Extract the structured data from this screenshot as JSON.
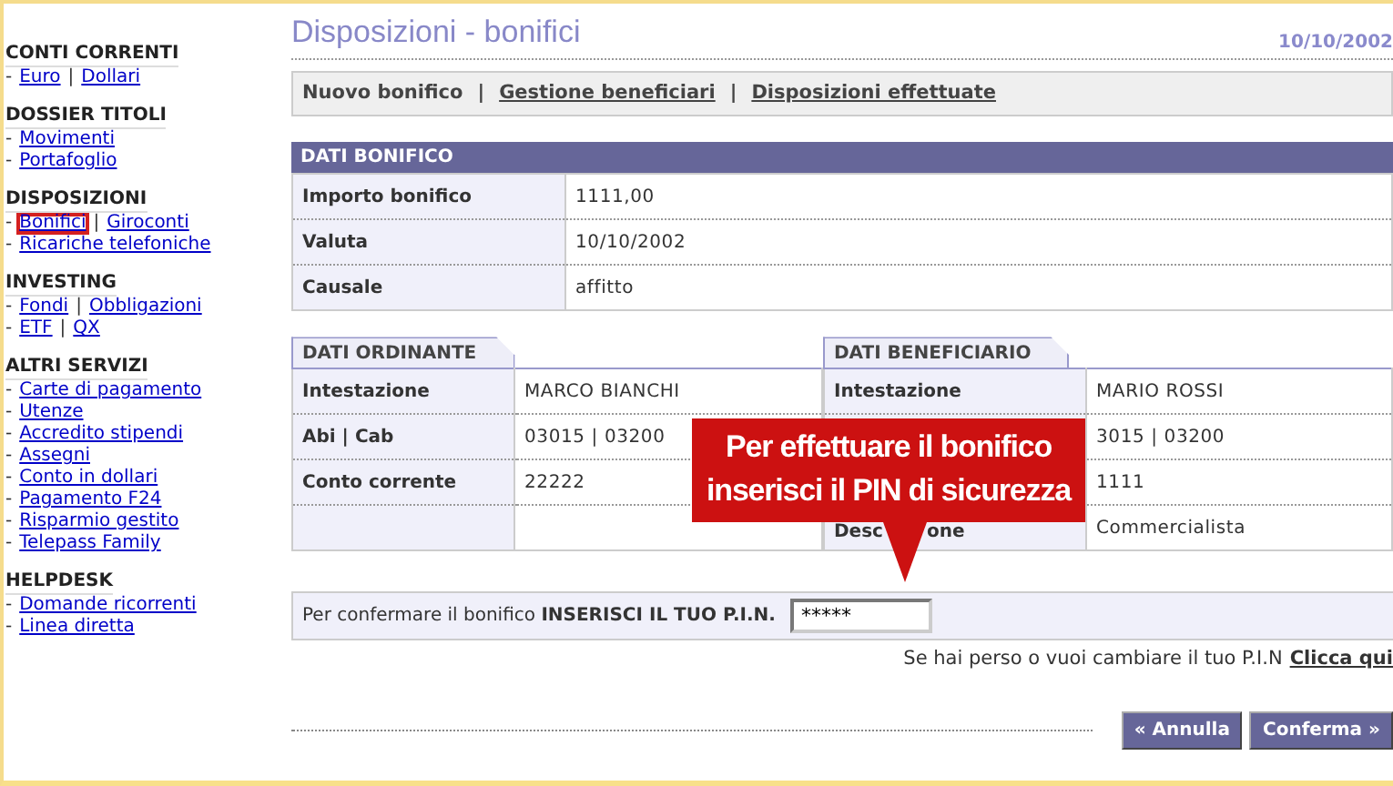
{
  "sidebar": [
    {
      "title": "CONTI CORRENTI",
      "lines": [
        {
          "marker": "-",
          "links": [
            {
              "label": "Euro",
              "highlighted": false
            },
            {
              "label": "Dollari",
              "highlighted": false
            }
          ],
          "separators": [
            "|"
          ]
        }
      ]
    },
    {
      "title": "DOSSIER TITOLI",
      "lines": [
        {
          "marker": "-",
          "links": [
            {
              "label": "Movimenti",
              "highlighted": false
            }
          ]
        },
        {
          "marker": "-",
          "links": [
            {
              "label": "Portafoglio",
              "highlighted": false
            }
          ]
        }
      ]
    },
    {
      "title": "DISPOSIZIONI",
      "lines": [
        {
          "marker": "-",
          "links": [
            {
              "label": "Bonifici",
              "highlighted": true
            },
            {
              "label": "Giroconti",
              "highlighted": false
            }
          ],
          "separators": [
            "|"
          ]
        },
        {
          "marker": "-",
          "links": [
            {
              "label": "Ricariche telefoniche",
              "highlighted": false
            }
          ]
        }
      ]
    },
    {
      "title": "INVESTING",
      "lines": [
        {
          "marker": "-",
          "links": [
            {
              "label": "Fondi",
              "highlighted": false
            },
            {
              "label": "Obbligazioni",
              "highlighted": false
            }
          ],
          "separators": [
            "|"
          ]
        },
        {
          "marker": "-",
          "links": [
            {
              "label": "ETF",
              "highlighted": false
            },
            {
              "label": "QX",
              "highlighted": false
            }
          ],
          "separators": [
            "|"
          ]
        }
      ]
    },
    {
      "title": "ALTRI SERVIZI",
      "lines": [
        {
          "marker": "-",
          "links": [
            {
              "label": "Carte di pagamento",
              "highlighted": false
            }
          ]
        },
        {
          "marker": "-",
          "links": [
            {
              "label": "Utenze",
              "highlighted": false
            }
          ]
        },
        {
          "marker": "-",
          "links": [
            {
              "label": "Accredito stipendi",
              "highlighted": false
            }
          ]
        },
        {
          "marker": "-",
          "links": [
            {
              "label": "Assegni",
              "highlighted": false
            }
          ]
        },
        {
          "marker": "-",
          "links": [
            {
              "label": "Conto in dollari",
              "highlighted": false
            }
          ]
        },
        {
          "marker": "-",
          "links": [
            {
              "label": "Pagamento F24",
              "highlighted": false
            }
          ]
        },
        {
          "marker": "-",
          "links": [
            {
              "label": "Risparmio gestito",
              "highlighted": false
            }
          ]
        },
        {
          "marker": "-",
          "links": [
            {
              "label": "Telepass Family",
              "highlighted": false
            }
          ]
        }
      ]
    },
    {
      "title": "HELPDESK",
      "lines": [
        {
          "marker": "-",
          "links": [
            {
              "label": "Domande ricorrenti",
              "highlighted": false
            }
          ]
        },
        {
          "marker": "-",
          "links": [
            {
              "label": "Linea diretta",
              "highlighted": false
            }
          ]
        }
      ]
    }
  ],
  "page": {
    "title": "Disposizioni - bonifici",
    "date": "10/10/2002"
  },
  "tabs": [
    {
      "label": "Nuovo bonifico",
      "selected": true
    },
    {
      "label": "Gestione beneficiari",
      "selected": false
    },
    {
      "label": "Disposizioni effettuate",
      "selected": false
    }
  ],
  "tab_separators": [
    "|",
    "|"
  ],
  "dati_bonifico": {
    "title": "DATI BONIFICO",
    "rows": [
      {
        "label": "Importo bonifico",
        "value": "1111,00"
      },
      {
        "label": "Valuta",
        "value": "10/10/2002"
      },
      {
        "label": "Causale",
        "value": "affitto"
      }
    ]
  },
  "dati_ordinante": {
    "title": "DATI ORDINANTE",
    "rows": [
      {
        "label": "Intestazione",
        "value": "MARCO BIANCHI"
      },
      {
        "label": "Abi | Cab",
        "value": "03015 | 03200"
      },
      {
        "label": "Conto corrente",
        "value": "22222"
      },
      {}
    ]
  },
  "dati_beneficiario": {
    "title": "DATI BENEFICIARIO",
    "rows": [
      {
        "label": "Intestazione",
        "value": "MARIO ROSSI"
      },
      {
        "value": "3015 | 03200"
      },
      {
        "value": "1111"
      },
      {
        "label_parts": [
          "Desc",
          "one"
        ],
        "value": "Commercialista"
      }
    ]
  },
  "pin": {
    "prompt": "Per confermare il bonifico **INSERISCI IL TUO P.I.N.**",
    "value": "*****",
    "help": "Se hai perso o vuoi cambiare il tuo P.I.N",
    "help_link": "Clicca qui"
  },
  "callout": {
    "lines": [
      "Per effettuare il bonifico",
      "inserisci il PIN di sicurezza"
    ]
  },
  "buttons": [
    {
      "label": "« Annulla"
    },
    {
      "label": "Conferma »"
    }
  ]
}
